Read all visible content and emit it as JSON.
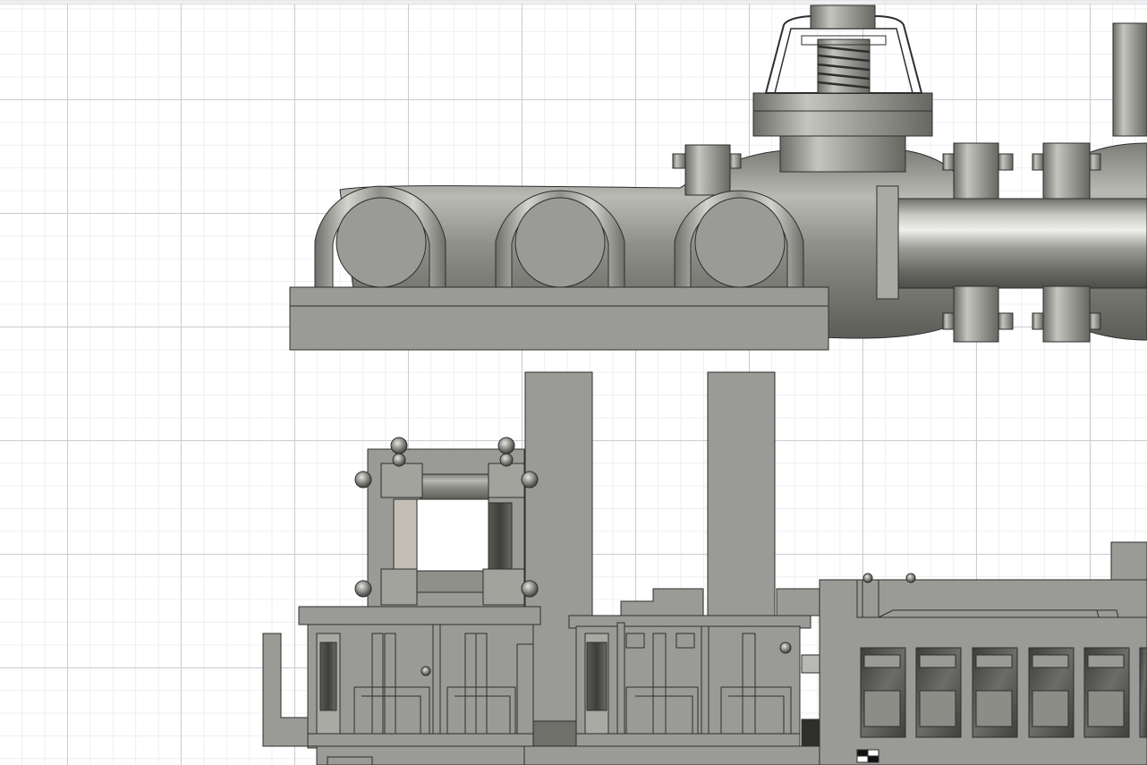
{
  "window": {
    "title": ""
  },
  "viewport": {
    "view": "Front",
    "visual_style": "Shaded with visible edges",
    "grid": true
  },
  "model": {
    "components": [
      "pipe-manifold",
      "valve-actuator",
      "u-bolt-clamps",
      "mounting-plate",
      "support-columns",
      "cage-frame",
      "lower-rack-assembly",
      "electrical-cabinet"
    ]
  },
  "colors": {
    "background": "#ffffff",
    "grid_major": "#c9ced3",
    "grid_minor": "#eceff1",
    "body_gray": "#9a9b96",
    "edge_line": "#2e2e2e",
    "metal_dark": "#55554f",
    "metal_light": "#d8d8d3"
  }
}
